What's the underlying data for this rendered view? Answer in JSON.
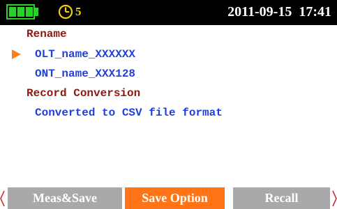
{
  "status_bar": {
    "battery_level": 1.0,
    "battery_color": "#2bd12b",
    "timer_icon": "clock-icon",
    "timer_count": "5",
    "date": "2011-09-15",
    "time": "17:41"
  },
  "content": {
    "rename_heading": "Rename",
    "rename_items": [
      {
        "label": "OLT_name_XXXXXX",
        "selected": true
      },
      {
        "label": "ONT_name_XXX128",
        "selected": false
      }
    ],
    "record_conversion_heading": "Record Conversion",
    "record_conversion_items": [
      {
        "label": "Converted to CSV file format"
      }
    ]
  },
  "tabs": [
    {
      "label": "Meas&Save",
      "active": false
    },
    {
      "label": "Save Option",
      "active": true
    },
    {
      "label": "Recall",
      "active": false
    }
  ],
  "colors": {
    "active_tab": "#ff7417",
    "inactive_tab": "#a9a9a9",
    "heading": "#8b1a10",
    "item": "#1f3fdc",
    "selection_cursor": "#ff7f1a",
    "nav_arrow": "#d8262a"
  },
  "nav": {
    "left_icon": "chevron-left-icon",
    "right_icon": "chevron-right-icon"
  }
}
